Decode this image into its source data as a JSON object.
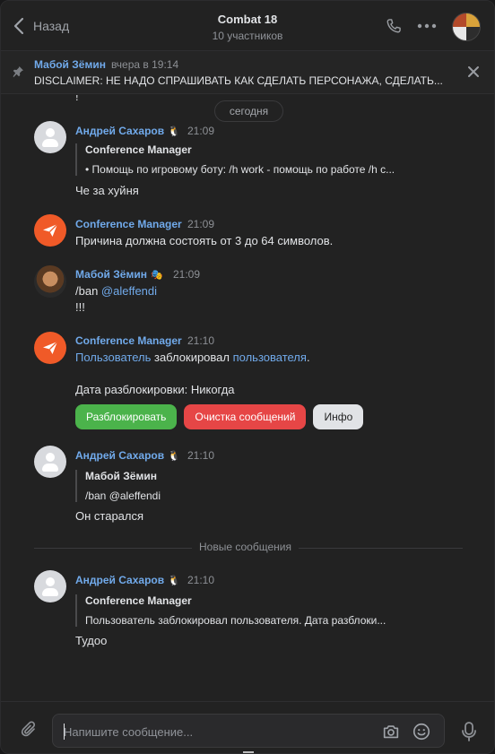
{
  "header": {
    "back_label": "Назад",
    "title": "Combat 18",
    "subtitle": "10 участников"
  },
  "pinned": {
    "author": "Мабой Зёмин",
    "time": "вчера в 19:14",
    "text": "DISCLAIMER: НЕ НАДО СПРАШИВАТЬ КАК СДЕЛАТЬ ПЕРСОНАЖА, СДЕЛАТЬ..."
  },
  "feed": {
    "cut_text": "!",
    "date_pill": "сегодня",
    "new_messages_label": "Новые сообщения"
  },
  "messages": [
    {
      "author": "Андрей Сахаров",
      "status": "🐧",
      "time": "21:09",
      "quote_author": "Conference Manager",
      "quote_text": "• Помощь по игровому боту: /h work - помощь по работе /h с...",
      "text": "Че за хуйня"
    },
    {
      "author": "Conference Manager",
      "time": "21:09",
      "text": "Причина должна состоять от 3 до 64 символов."
    },
    {
      "author": "Мабой Зёмин",
      "status": "🎭",
      "time": "21:09",
      "text_prefix": "/ban ",
      "mention": "@aleffendi",
      "text2": "!!!"
    },
    {
      "author": "Conference Manager",
      "time": "21:10",
      "link1": "Пользователь",
      "middle": " заблокировал ",
      "link2": "пользователя",
      "end": ".",
      "text2": "Дата разблокировки: Никогда",
      "buttons": [
        "Разблокировать",
        "Очистка сообщений",
        "Инфо"
      ]
    },
    {
      "author": "Андрей Сахаров",
      "status": "🐧",
      "time": "21:10",
      "quote_author": "Мабой Зёмин",
      "quote_text": "/ban @aleffendi",
      "text": "Он старался"
    },
    {
      "author": "Андрей Сахаров",
      "status": "🐧",
      "time": "21:10",
      "quote_author": "Conference Manager",
      "quote_text": "Пользователь заблокировал пользователя. Дата разблоки...",
      "text": "Тудоо"
    }
  ],
  "composer": {
    "placeholder": "Напишите сообщение..."
  },
  "colors": {
    "accent": "#71aaeb",
    "green_button": "#4bb34b",
    "red_button": "#e64646",
    "bot_avatar": "#f05a28"
  }
}
